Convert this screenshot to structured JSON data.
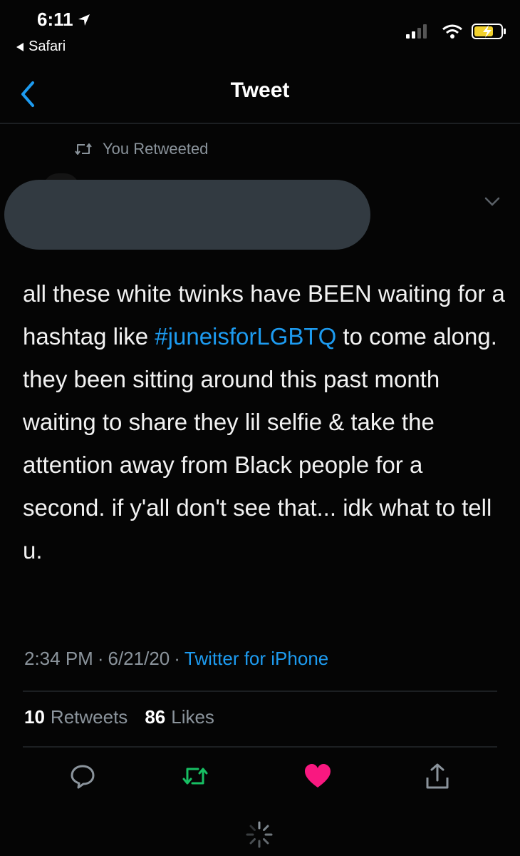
{
  "status_bar": {
    "time": "6:11",
    "back_app": "Safari",
    "icons": [
      "location-arrow-icon",
      "signal-icon",
      "wifi-icon",
      "battery-charging-icon"
    ]
  },
  "nav": {
    "title": "Tweet",
    "back_icon": "chevron-left-icon"
  },
  "context": {
    "retweet_label": "You Retweeted"
  },
  "tweet": {
    "body_before": "all these white twinks have BEEN waiting for a hashtag like ",
    "hashtag": "#juneisforLGBTQ",
    "body_after": " to come along. they been sitting around this past month waiting to share they lil selfie & take the attention away from Black people for a second. if y'all don't see that... idk what to tell u.",
    "time": "2:34 PM",
    "date": "6/21/20",
    "source": "Twitter for iPhone",
    "retweets_count": "10",
    "retweets_label": "Retweets",
    "likes_count": "86",
    "likes_label": "Likes"
  },
  "colors": {
    "background": "#050505",
    "link": "#1d9bf0",
    "retweet_green": "#17bf63",
    "like_pink": "#f91880",
    "muted": "#8b949c"
  },
  "actions": [
    "reply-icon",
    "retweet-icon",
    "like-icon",
    "share-icon"
  ]
}
